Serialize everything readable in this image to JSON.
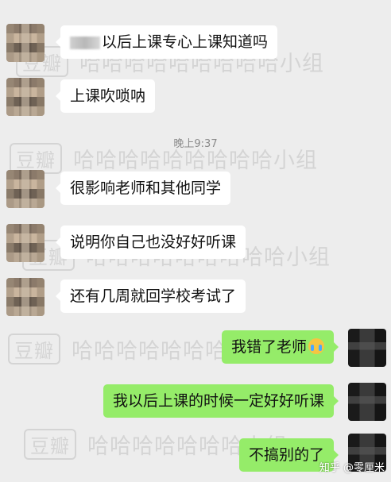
{
  "watermark": {
    "logo": "豆瓣",
    "group_text": "哈哈哈哈哈哈哈哈哈小组",
    "group_text_short": "哈哈哈哈哈哈哈小组"
  },
  "messages": [
    {
      "side": "left",
      "text": "以后上课专心上课知道吗"
    },
    {
      "side": "left",
      "text": "上课吹唢呐"
    },
    {
      "side": "left",
      "text": "很影响老师和其他同学"
    },
    {
      "side": "left",
      "text": "说明你自己也没好好听课"
    },
    {
      "side": "left",
      "text": "还有几周就回学校考试了"
    },
    {
      "side": "right",
      "text": "我错了老师"
    },
    {
      "side": "right",
      "text": "我以后上课的时候一定好好听课"
    },
    {
      "side": "right",
      "text": "不搞别的了"
    }
  ],
  "timestamp": "晚上9:37",
  "credit": "知乎 @零厘米",
  "colors": {
    "background": "#ededed",
    "left_bubble": "#ffffff",
    "right_bubble": "#95ec69"
  },
  "icons": {
    "emoji": "crying-face-icon"
  }
}
